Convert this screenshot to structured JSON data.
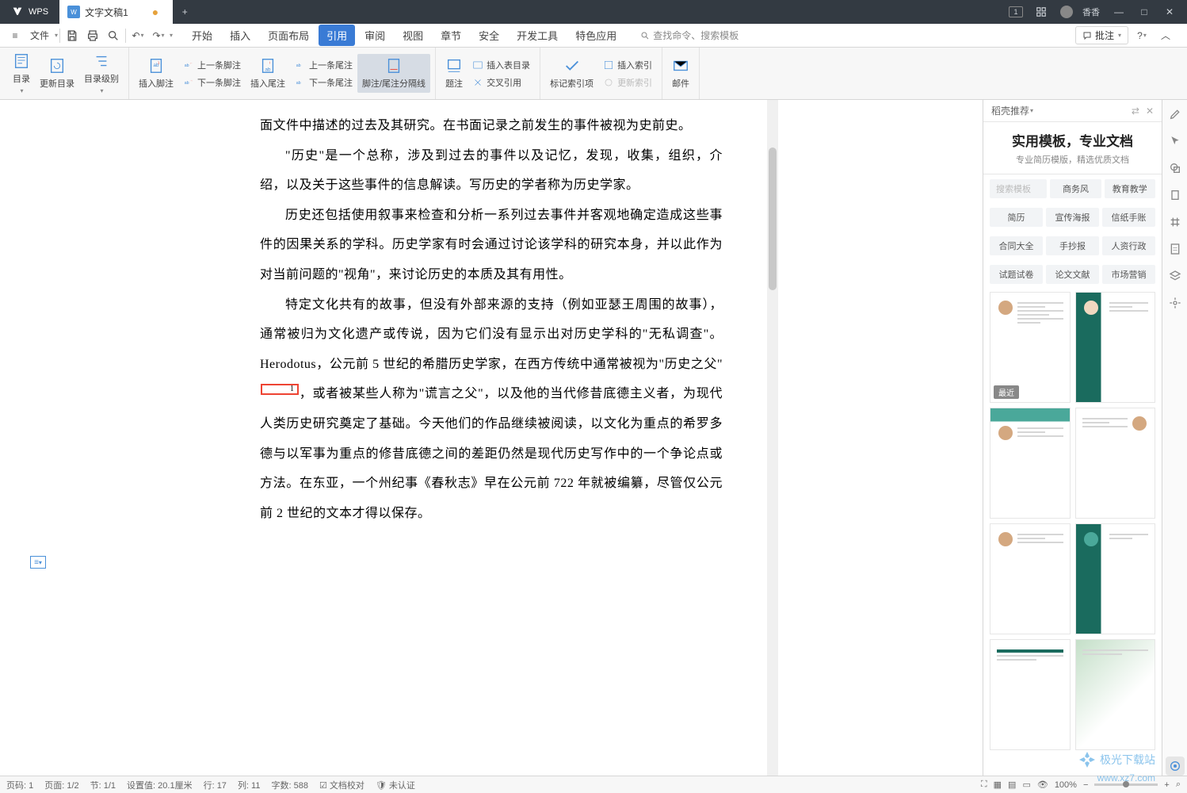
{
  "titlebar": {
    "logo": "WPS",
    "tab_name": "文字文稿1",
    "window_badge": "1",
    "username": "香香"
  },
  "menubar": {
    "file": "文件",
    "tabs": [
      "开始",
      "插入",
      "页面布局",
      "引用",
      "审阅",
      "视图",
      "章节",
      "安全",
      "开发工具",
      "特色应用"
    ],
    "active_tab": "引用",
    "search": "查找命令、搜索模板",
    "annotate": "批注"
  },
  "ribbon": {
    "g1": {
      "toc": "目录",
      "update": "更新目录",
      "level": "目录级别"
    },
    "g2": {
      "insert_fn": "插入脚注",
      "prev_fn": "上一条脚注",
      "next_fn": "下一条脚注",
      "insert_en": "插入尾注",
      "prev_en": "上一条尾注",
      "next_en": "下一条尾注",
      "separator": "脚注/尾注分隔线"
    },
    "g3": {
      "caption": "题注",
      "insert_toc": "插入表目录",
      "crossref": "交叉引用"
    },
    "g4": {
      "mark_index": "标记索引项",
      "insert_index": "插入索引",
      "update_index": "更新索引"
    },
    "g5": {
      "mail": "邮件"
    }
  },
  "document": {
    "p1": "面文件中描述的过去及其研究。在书面记录之前发生的事件被视为史前史。",
    "p2": "\"历史\"是一个总称，涉及到过去的事件以及记忆，发现，收集，组织，介绍，以及关于这些事件的信息解读。写历史的学者称为历史学家。",
    "p3": "历史还包括使用叙事来检查和分析一系列过去事件并客观地确定造成这些事件的因果关系的学科。历史学家有时会通过讨论该学科的研究本身，并以此作为对当前问题的\"视角\"，来讨论历史的本质及其有用性。",
    "p4a": "特定文化共有的故事，但没有外部来源的支持（例如亚瑟王周围的故事），通常被归为文化遗产或传说，因为它们没有显示出对历史学科的\"无私调查\"。 Herodotus，公元前 5 世纪的希腊历史学家，在西方传统中通常被视为\"历史之父\"",
    "p4_ref": "1",
    "p4b": "，或者被某些人称为\"谎言之父\"，以及他的当代修昔底德主义者，为现代人类历史研究奠定了基础。今天他们的作品继续被阅读，以文化为重点的希罗多德与以军事为重点的修昔底德之间的差距仍然是现代历史写作中的一个争论点或方法。在东亚，一个州纪事《春秋志》早在公元前 722 年就被编纂，尽管仅公元前 2 世纪的文本才得以保存。"
  },
  "panel": {
    "title": "稻壳推荐",
    "promo_title": "实用模板，专业文档",
    "promo_sub": "专业简历模版，精选优质文档",
    "search_placeholder": "搜索模板",
    "filters1": [
      "商务风",
      "教育教学"
    ],
    "filters2": [
      "简历",
      "宣传海报",
      "信纸手账"
    ],
    "filters3": [
      "合同大全",
      "手抄报",
      "人资行政"
    ],
    "filters4": [
      "试题试卷",
      "论文文献",
      "市场营销"
    ],
    "recent_badge": "最近"
  },
  "statusbar": {
    "page_num": "页码: 1",
    "page": "页面: 1/2",
    "section": "节: 1/1",
    "position": "设置值: 20.1厘米",
    "line": "行: 17",
    "col": "列: 11",
    "words": "字数: 588",
    "proof": "文档校对",
    "verify": "未认证",
    "zoom": "100%"
  },
  "watermark": {
    "brand": "极光下载站",
    "url": "www.xz7.com"
  }
}
